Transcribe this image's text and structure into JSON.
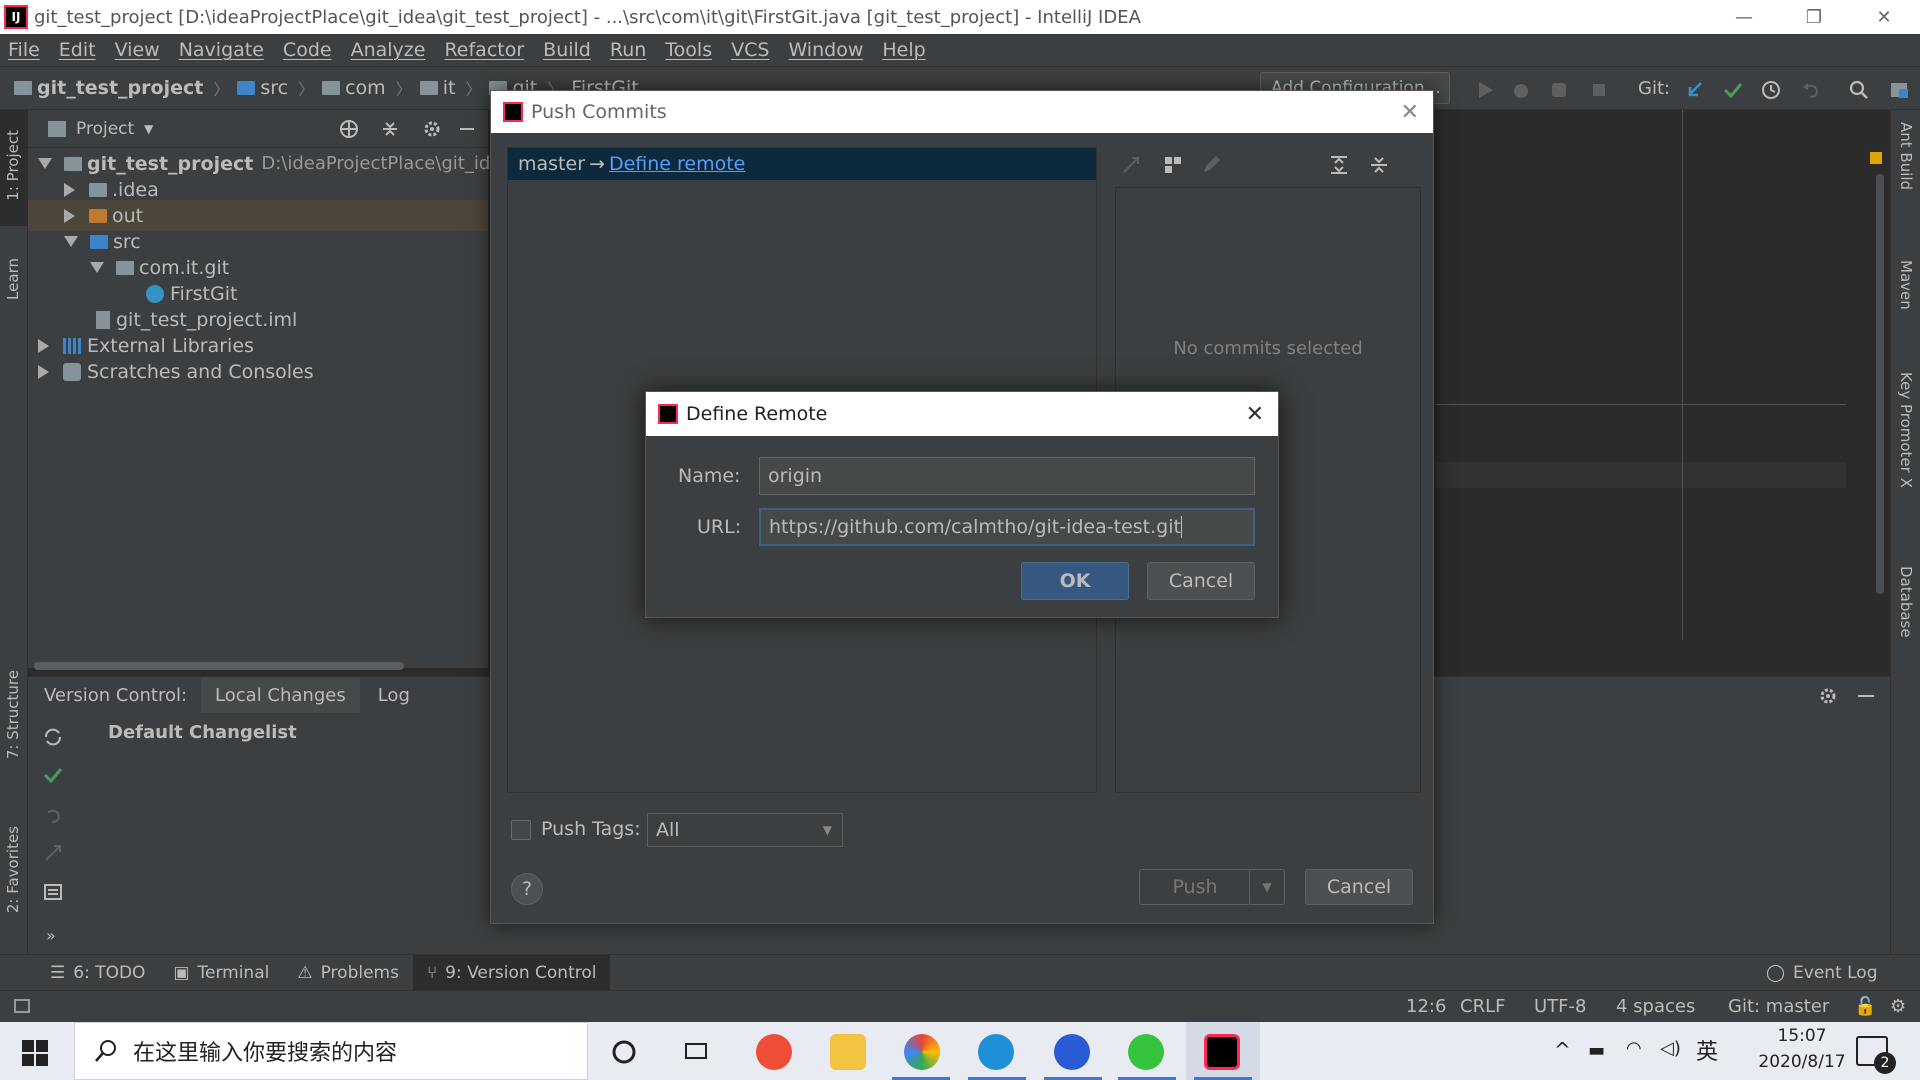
{
  "window": {
    "title": "git_test_project [D:\\ideaProjectPlace\\git_idea\\git_test_project] - ...\\src\\com\\it\\git\\FirstGit.java [git_test_project] - IntelliJ IDEA",
    "app_icon_label": "IJ"
  },
  "menu": [
    "File",
    "Edit",
    "View",
    "Navigate",
    "Code",
    "Analyze",
    "Refactor",
    "Build",
    "Run",
    "Tools",
    "VCS",
    "Window",
    "Help"
  ],
  "breadcrumbs": [
    "git_test_project",
    "src",
    "com",
    "it",
    "git",
    "FirstGit"
  ],
  "toolbar": {
    "add_config": "Add Configuration...",
    "git_label": "Git:"
  },
  "project_panel": {
    "title": "Project",
    "root_name": "git_test_project",
    "root_path": "D:\\ideaProjectPlace\\git_idea\\",
    "items": [
      ".idea",
      "out",
      "src",
      "com.it.git",
      "FirstGit",
      "git_test_project.iml",
      "External Libraries",
      "Scratches and Consoles"
    ]
  },
  "left_stripe": [
    "1: Project",
    "Learn",
    "7: Structure",
    "2: Favorites"
  ],
  "right_stripe": [
    "Ant Build",
    "Maven",
    "Key Promoter X",
    "Database"
  ],
  "version_control": {
    "label": "Version Control:",
    "tabs": [
      "Local Changes",
      "Log"
    ],
    "changelist": "Default Changelist"
  },
  "bottom_tabs": [
    "6: TODO",
    "Terminal",
    "Problems",
    "9: Version Control",
    "Event Log"
  ],
  "status": {
    "position": "12:6",
    "line_sep": "CRLF",
    "encoding": "UTF-8",
    "indent": "4 spaces",
    "branch": "Git: master"
  },
  "push_dialog": {
    "title": "Push Commits",
    "branch": "master",
    "arrow": "→",
    "define_remote_link": "Define remote",
    "no_commits": "No commits selected",
    "push_tags_label": "Push Tags:",
    "tags_option": "All",
    "push_button": "Push",
    "cancel_button": "Cancel",
    "help": "?"
  },
  "define_remote": {
    "title": "Define Remote",
    "name_label": "Name:",
    "name_value": "origin",
    "url_label": "URL:",
    "url_value": "https://github.com/calmtho/git-idea-test.git",
    "ok_button": "OK",
    "cancel_button": "Cancel"
  },
  "taskbar": {
    "search_placeholder": "在这里输入你要搜索的内容",
    "ime": "英",
    "time": "15:07",
    "date": "2020/8/17",
    "notif_count": "2"
  },
  "colors": {
    "ide_bg": "#3c3f41",
    "editor_bg": "#2b2b2b",
    "selection": "#0d293e",
    "link": "#589df6",
    "primary_button": "#365880"
  }
}
